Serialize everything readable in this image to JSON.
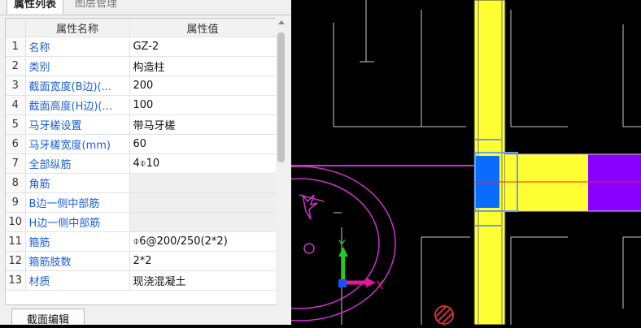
{
  "tabs": {
    "properties": "属性列表",
    "layers": "图层管理"
  },
  "table": {
    "header_name": "属性名称",
    "header_value": "属性值",
    "rows": [
      {
        "num": "1",
        "name": "名称",
        "value": "GZ-2"
      },
      {
        "num": "2",
        "name": "类别",
        "value": "构造柱"
      },
      {
        "num": "3",
        "name": "截面宽度(B边)(...",
        "value": "200"
      },
      {
        "num": "4",
        "name": "截面高度(H边)(...",
        "value": "100"
      },
      {
        "num": "5",
        "name": "马牙槎设置",
        "value": "带马牙槎"
      },
      {
        "num": "6",
        "name": "马牙槎宽度(mm)",
        "value": "60"
      },
      {
        "num": "7",
        "name": "全部纵筋",
        "value": "4⌽10"
      },
      {
        "num": "8",
        "name": "角筋",
        "value": ""
      },
      {
        "num": "9",
        "name": "B边一侧中部筋",
        "value": ""
      },
      {
        "num": "10",
        "name": "H边一侧中部筋",
        "value": ""
      },
      {
        "num": "11",
        "name": "箍筋",
        "value": "⌽6@200/250(2*2)"
      },
      {
        "num": "12",
        "name": "箍筋肢数",
        "value": "2*2"
      },
      {
        "num": "13",
        "name": "材质",
        "value": "现浇混凝土"
      }
    ]
  },
  "buttons": {
    "section_edit": "截面编辑"
  },
  "canvas": {
    "axis_x_label": "X",
    "axis_y_label": "Y",
    "colors": {
      "background": "#000000",
      "column": "#ffff33",
      "beam_end": "#8800ff",
      "section_blue": "#0a6cff",
      "ring": "#cc33cc",
      "axis_x": "#e0189a",
      "axis_y": "#22cc22",
      "grid": "#c8c8c8"
    }
  }
}
